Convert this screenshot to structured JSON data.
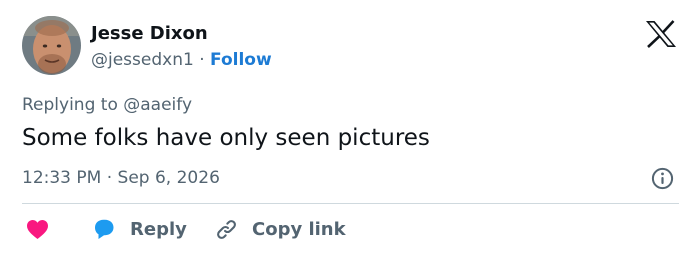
{
  "author": {
    "name": "Jesse Dixon",
    "handle": "@jessedxn1",
    "separator": "·",
    "follow_label": "Follow"
  },
  "tweet": {
    "replying_prefix": "Replying to",
    "replying_to": "@aaeify",
    "text": "Some folks have only seen pictures",
    "time": "12:33 PM",
    "date_separator": "·",
    "date": "Sep 6, 2026"
  },
  "actions": {
    "reply_label": "Reply",
    "copy_label": "Copy link"
  },
  "icons": {
    "brand": "x-logo-icon",
    "info": "info-icon",
    "like": "heart-icon",
    "reply": "speech-bubble-icon",
    "copy": "link-icon"
  },
  "colors": {
    "text": "#0f1419",
    "muted": "#536471",
    "link": "#1d7bd4",
    "heart": "#f91880",
    "reply": "#1d9bf0",
    "divider": "#cfd9de"
  }
}
